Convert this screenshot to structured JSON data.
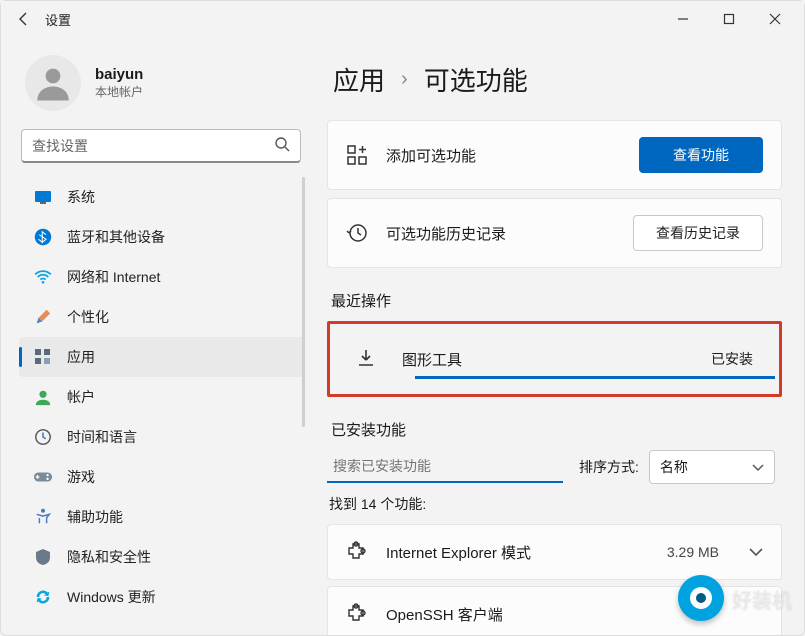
{
  "window": {
    "title": "设置"
  },
  "user": {
    "name": "baiyun",
    "subtitle": "本地帐户"
  },
  "search": {
    "placeholder": "查找设置"
  },
  "nav": {
    "items": [
      {
        "label": "系统",
        "icon": "system-icon"
      },
      {
        "label": "蓝牙和其他设备",
        "icon": "bluetooth-icon"
      },
      {
        "label": "网络和 Internet",
        "icon": "wifi-icon"
      },
      {
        "label": "个性化",
        "icon": "personalize-icon"
      },
      {
        "label": "应用",
        "icon": "apps-icon",
        "selected": true
      },
      {
        "label": "帐户",
        "icon": "account-icon"
      },
      {
        "label": "时间和语言",
        "icon": "time-icon"
      },
      {
        "label": "游戏",
        "icon": "gaming-icon"
      },
      {
        "label": "辅助功能",
        "icon": "accessibility-icon"
      },
      {
        "label": "隐私和安全性",
        "icon": "privacy-icon"
      },
      {
        "label": "Windows 更新",
        "icon": "update-icon"
      }
    ]
  },
  "breadcrumb": {
    "level1": "应用",
    "level2": "可选功能"
  },
  "add_card": {
    "label": "添加可选功能",
    "button": "查看功能"
  },
  "history_card": {
    "label": "可选功能历史记录",
    "button": "查看历史记录"
  },
  "recent": {
    "heading": "最近操作",
    "item": {
      "name": "图形工具",
      "status": "已安装"
    }
  },
  "installed": {
    "heading": "已安装功能",
    "search_placeholder": "搜索已安装功能",
    "sort_label": "排序方式:",
    "sort_value": "名称",
    "found": "找到 14 个功能:",
    "features": [
      {
        "name": "Internet Explorer 模式",
        "size": "3.29 MB"
      },
      {
        "name": "OpenSSH 客户端",
        "size": ""
      }
    ]
  },
  "watermark": {
    "text": "好装机"
  }
}
